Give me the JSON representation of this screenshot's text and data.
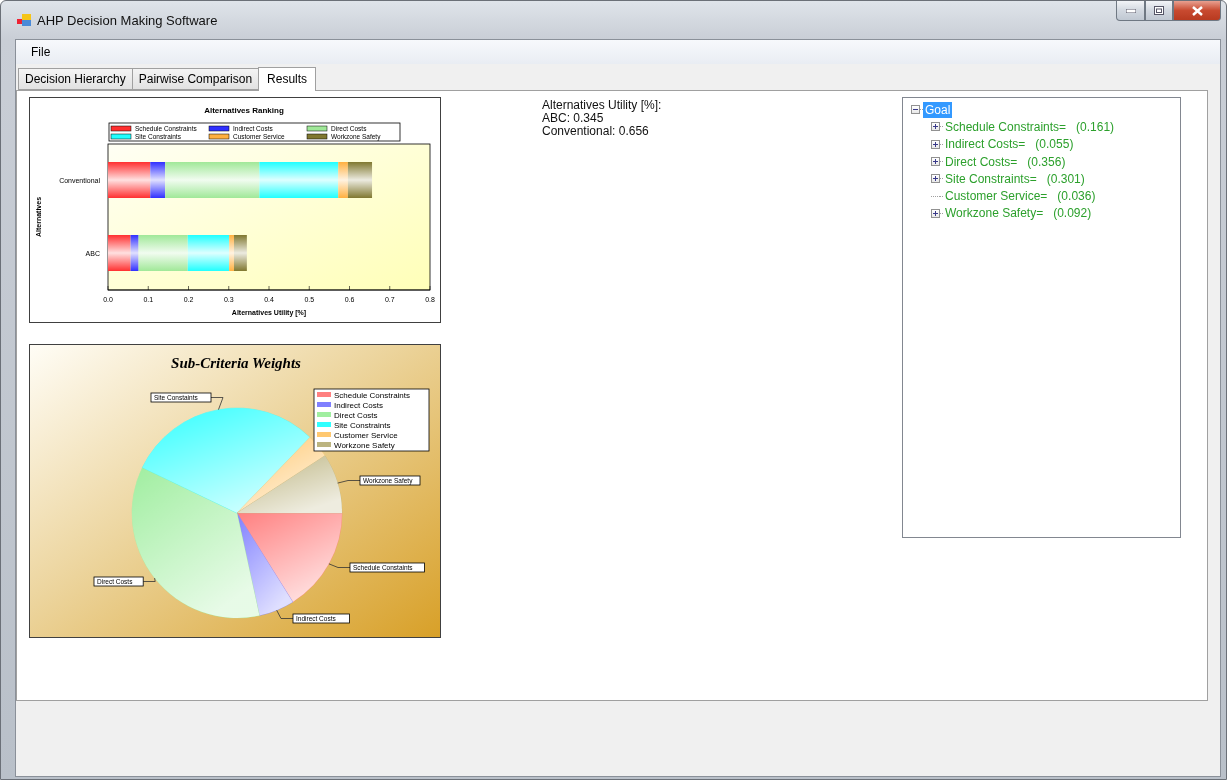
{
  "window": {
    "title": "AHP Decision Making Software"
  },
  "menu": [
    "File"
  ],
  "tabs": [
    {
      "label": "Decision Hierarchy",
      "selected": false
    },
    {
      "label": "Pairwise Comparison",
      "selected": false
    },
    {
      "label": "Results",
      "selected": true
    }
  ],
  "ranking_chart": {
    "chart_data": {
      "type": "bar",
      "orientation": "horizontal",
      "stacked": true,
      "legend": "top",
      "title": "Alternatives Ranking",
      "xlabel": "Alternatives Utility [%]",
      "ylabel": "Alternatives",
      "categories": [
        "Conventional",
        "ABC"
      ],
      "xlim": [
        0,
        0.8
      ],
      "xticks": [
        {
          "value": 0,
          "label": "0.0"
        },
        {
          "value": 0.1,
          "label": "0.1"
        },
        {
          "value": 0.2,
          "label": "0.2"
        },
        {
          "value": 0.3,
          "label": "0.3"
        },
        {
          "value": 0.4,
          "label": "0.4"
        },
        {
          "value": 0.5,
          "label": "0.5"
        },
        {
          "value": 0.6,
          "label": "0.6"
        },
        {
          "value": 0.7,
          "label": "0.7"
        },
        {
          "value": 0.8,
          "label": "0.8"
        }
      ],
      "series": [
        {
          "name": "Schedule Constraints",
          "color": "#ff3030",
          "values": [
            0.105,
            0.056
          ]
        },
        {
          "name": "Indirect Costs",
          "color": "#3030ff",
          "values": [
            0.037,
            0.02
          ]
        },
        {
          "name": "Direct Costs",
          "color": "#a0e898",
          "values": [
            0.234,
            0.122
          ]
        },
        {
          "name": "Site Constraints",
          "color": "#20ffff",
          "values": [
            0.196,
            0.103
          ]
        },
        {
          "name": "Customer Service",
          "color": "#ffb040",
          "values": [
            0.024,
            0.012
          ]
        },
        {
          "name": "Workzone Safety",
          "color": "#807830",
          "values": [
            0.06,
            0.032
          ]
        }
      ]
    }
  },
  "weights_chart": {
    "chart_data": {
      "type": "pie",
      "title": "Sub-Criteria Weights",
      "categories": [
        "Schedule Constraints",
        "Indirect Costs",
        "Direct Costs",
        "Site Constraints",
        "Customer Service",
        "Workzone Safety"
      ],
      "values": [
        0.161,
        0.055,
        0.356,
        0.301,
        0.036,
        0.092
      ],
      "colors": [
        "#ff8080",
        "#8080ff",
        "#a0eea0",
        "#30ffff",
        "#ffc870",
        "#bcb480"
      ],
      "legend": "right"
    },
    "callouts": [
      "Site Constaints",
      "Workzone Safety",
      "Schedule Constaints",
      "Indirect Costs",
      "Direct Costs"
    ]
  },
  "utility_summary": [
    "Alternatives Utility [%]:",
    "ABC: 0.345",
    "Conventional: 0.656"
  ],
  "tree": {
    "label": "Goal",
    "selected": true,
    "expanded": true,
    "children": [
      {
        "label": "Schedule Constraints=   (0.161)",
        "kind": "branch"
      },
      {
        "label": "Indirect Costs=   (0.055)",
        "kind": "branch"
      },
      {
        "label": "Direct Costs=   (0.356)",
        "kind": "branch"
      },
      {
        "label": "Site Constraints=   (0.301)",
        "kind": "branch"
      },
      {
        "label": "Customer Service=   (0.036)",
        "kind": "leaf"
      },
      {
        "label": "Workzone Safety=   (0.092)",
        "kind": "branch"
      }
    ]
  }
}
